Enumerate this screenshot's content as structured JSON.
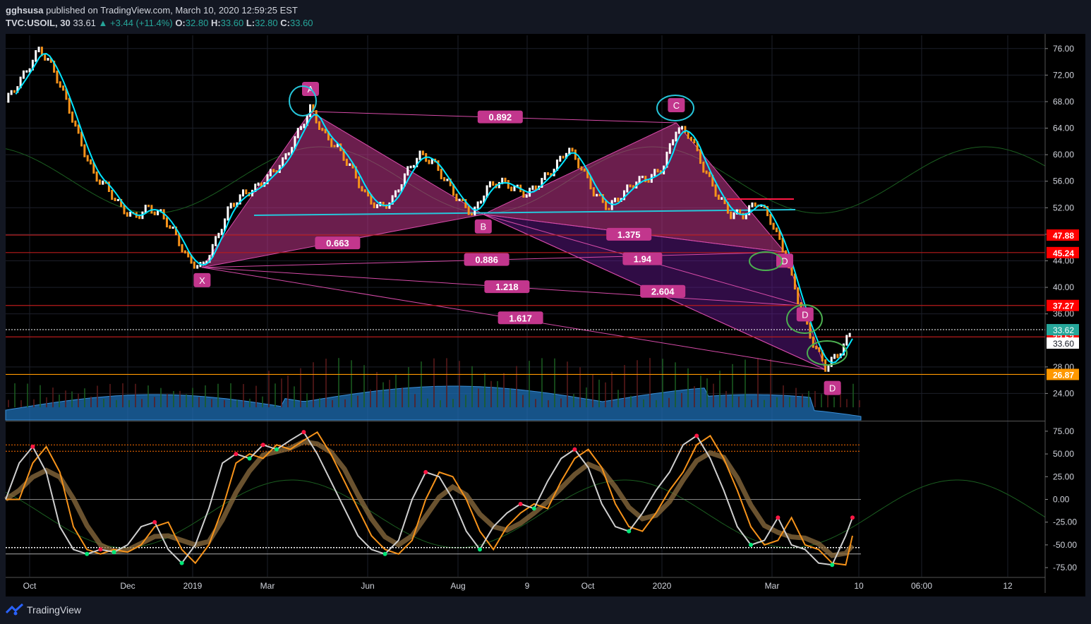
{
  "header": {
    "author": "gghsusa",
    "published_text": "published on TradingView.com, March 10, 2020 12:59:25 EST",
    "symbol": "TVC:USOIL, 30",
    "last": "33.61",
    "change": "▲ +3.44 (+11.4%)",
    "o_label": "O:",
    "o_val": "32.80",
    "h_label": "H:",
    "h_val": "33.60",
    "l_label": "L:",
    "l_val": "32.80",
    "c_label": "C:",
    "c_val": "33.60"
  },
  "footer": {
    "brand": "TradingView"
  },
  "colors": {
    "background": "#131722",
    "up_candle": "#ffffff",
    "down_candle": "#f7931a",
    "ma_line": "#00e5ff",
    "pattern_fill": "#c2368d",
    "level_line": "#b71c1c",
    "support_line": "#26c6da",
    "sine_wave": "#1b5e20",
    "volume": "#1e6fb5"
  },
  "chart_data": [
    {
      "type": "line",
      "panel": "price",
      "y_ticks": [
        76,
        72,
        68,
        64,
        60,
        56,
        52,
        48,
        44,
        40,
        36,
        28,
        24
      ],
      "y_tick_labels": [
        "76.00",
        "72.00",
        "68.00",
        "64.00",
        "60.00",
        "56.00",
        "52.00",
        "48.00",
        "44.00",
        "40.00",
        "36.00",
        "28.00",
        "24.00"
      ],
      "ylim": [
        20,
        78
      ],
      "x_ticks": [
        "Oct",
        "Dec",
        "2019",
        "Mar",
        "Jun",
        "Aug",
        "9",
        "Oct",
        "2020",
        "Mar",
        "10",
        "06:00",
        "12"
      ],
      "close_path": [
        [
          0,
          68
        ],
        [
          3,
          72.5
        ],
        [
          5,
          76
        ],
        [
          7,
          73
        ],
        [
          9,
          68
        ],
        [
          11,
          62
        ],
        [
          13,
          57
        ],
        [
          15,
          55
        ],
        [
          17,
          52
        ],
        [
          19,
          50.5
        ],
        [
          21,
          52
        ],
        [
          23,
          51
        ],
        [
          25,
          48
        ],
        [
          27,
          44
        ],
        [
          29,
          43
        ],
        [
          31,
          47
        ],
        [
          33,
          52
        ],
        [
          35,
          54
        ],
        [
          37,
          55
        ],
        [
          39,
          57
        ],
        [
          41,
          59
        ],
        [
          43,
          63
        ],
        [
          45,
          67
        ],
        [
          47,
          63
        ],
        [
          49,
          61
        ],
        [
          51,
          58
        ],
        [
          53,
          54
        ],
        [
          55,
          52
        ],
        [
          57,
          53
        ],
        [
          59,
          57
        ],
        [
          61,
          60
        ],
        [
          63,
          59
        ],
        [
          65,
          56
        ],
        [
          67,
          53
        ],
        [
          69,
          51
        ],
        [
          71,
          55
        ],
        [
          73,
          56
        ],
        [
          75,
          55
        ],
        [
          77,
          54
        ],
        [
          79,
          56
        ],
        [
          81,
          58
        ],
        [
          83,
          61
        ],
        [
          85,
          58
        ],
        [
          87,
          54
        ],
        [
          89,
          52
        ],
        [
          91,
          54
        ],
        [
          93,
          56
        ],
        [
          95,
          56.5
        ],
        [
          97,
          58
        ],
        [
          99,
          64
        ],
        [
          101,
          63
        ],
        [
          103,
          58
        ],
        [
          105,
          54
        ],
        [
          107,
          51
        ],
        [
          109,
          51
        ],
        [
          111,
          53
        ],
        [
          113,
          50
        ],
        [
          115,
          45
        ],
        [
          117,
          38
        ],
        [
          119,
          32
        ],
        [
          121,
          28
        ],
        [
          123,
          30
        ],
        [
          125,
          33.6
        ]
      ],
      "levels": [
        {
          "value": 47.88,
          "label": "47.88",
          "color": "#ff0000"
        },
        {
          "value": 45.24,
          "label": "45.24",
          "color": "#ff0000"
        },
        {
          "value": 37.27,
          "label": "37.27",
          "color": "#ff0000"
        },
        {
          "value": 32.53,
          "label": "32.53",
          "color": "#ff0000"
        },
        {
          "value": 26.87,
          "label": "26.87",
          "color": "#ff9800"
        }
      ],
      "current_price": {
        "value": 33.62,
        "label": "33.62"
      },
      "current_close_label": "33.60",
      "pattern_points": [
        {
          "name": "X",
          "x": 29,
          "y": 43
        },
        {
          "name": "A",
          "x": 45,
          "y": 66.5
        },
        {
          "name": "B",
          "x": 70.5,
          "y": 51
        },
        {
          "name": "C",
          "x": 99,
          "y": 64.8
        },
        {
          "name": "D",
          "x": 115,
          "y": 45.3
        },
        {
          "name": "D",
          "x": 118,
          "y": 37.2
        },
        {
          "name": "D",
          "x": 121,
          "y": 27.6
        }
      ],
      "ratios": [
        {
          "label": "0.892",
          "x": 73,
          "y": 65.7
        },
        {
          "label": "0.663",
          "x": 49,
          "y": 46.7
        },
        {
          "label": "0.886",
          "x": 71,
          "y": 44.2
        },
        {
          "label": "1.375",
          "x": 92,
          "y": 48.0
        },
        {
          "label": "1.94",
          "x": 94,
          "y": 44.3
        },
        {
          "label": "1.218",
          "x": 74,
          "y": 40.1
        },
        {
          "label": "2.604",
          "x": 97,
          "y": 39.4
        },
        {
          "label": "1.617",
          "x": 76,
          "y": 35.4
        }
      ]
    },
    {
      "type": "line",
      "panel": "oscillator",
      "y_ticks": [
        75,
        50,
        25,
        0,
        -25,
        -50,
        -75
      ],
      "y_tick_labels": [
        "75.00",
        "50.00",
        "25.00",
        "0.00",
        "-25.00",
        "-50.00",
        "-75.00"
      ],
      "ylim": [
        -85,
        85
      ],
      "series": [
        {
          "name": "",
          "x": [
            0,
            2,
            4,
            6,
            8,
            10,
            12,
            14,
            16,
            18,
            20,
            22,
            24,
            26,
            28,
            30,
            32,
            34,
            36,
            38,
            40,
            42,
            44,
            46,
            48,
            50,
            52,
            54,
            56,
            58,
            60,
            62,
            64,
            66,
            68,
            70,
            72,
            74,
            76,
            78,
            80,
            82,
            84,
            86,
            88,
            90,
            92,
            94,
            96,
            98,
            100,
            102,
            104,
            106,
            108,
            110,
            112,
            114,
            116,
            118,
            120,
            122,
            124,
            125
          ],
          "values": [
            0,
            40,
            58,
            30,
            -30,
            -55,
            -60,
            -55,
            -58,
            -50,
            -30,
            -25,
            -55,
            -70,
            -50,
            -10,
            40,
            50,
            45,
            60,
            55,
            65,
            74,
            50,
            20,
            -10,
            -40,
            -55,
            -60,
            -45,
            0,
            30,
            25,
            0,
            -35,
            -55,
            -30,
            -15,
            -5,
            -10,
            20,
            45,
            55,
            35,
            -5,
            -30,
            -35,
            -15,
            10,
            30,
            60,
            70,
            45,
            10,
            -30,
            -50,
            -45,
            -20,
            -50,
            -55,
            -70,
            -72,
            -40,
            -20
          ]
        }
      ]
    }
  ]
}
